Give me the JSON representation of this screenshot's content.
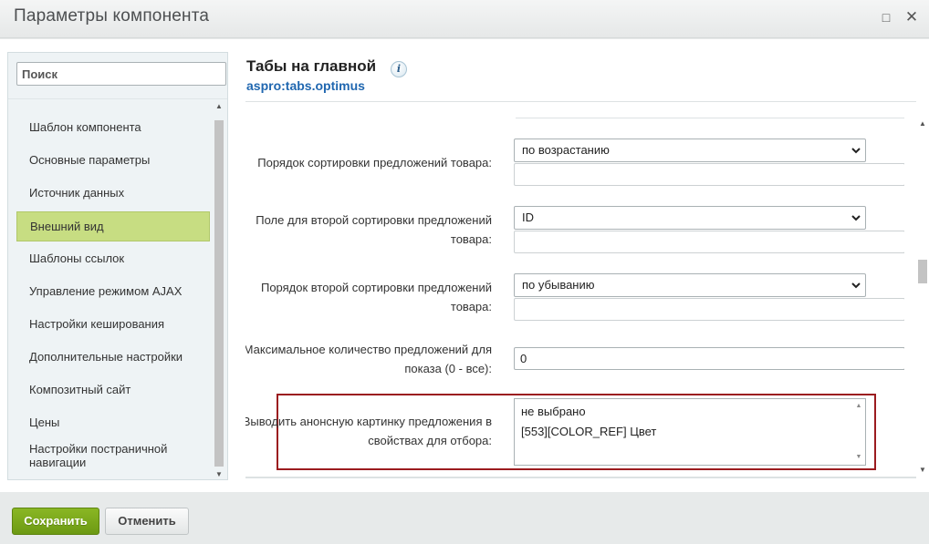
{
  "window": {
    "title": "Параметры компонента",
    "maximize_icon": "□",
    "close_icon": "✕"
  },
  "sidebar": {
    "search_placeholder": "Поиск",
    "items": [
      {
        "label": "Шаблон компонента"
      },
      {
        "label": "Основные параметры"
      },
      {
        "label": "Источник данных"
      },
      {
        "label": "Внешний вид",
        "active": true
      },
      {
        "label": "Шаблоны ссылок"
      },
      {
        "label": "Управление режимом AJAX"
      },
      {
        "label": "Настройки кеширования"
      },
      {
        "label": "Дополнительные настройки"
      },
      {
        "label": "Композитный сайт"
      },
      {
        "label": "Цены"
      },
      {
        "label": "Настройки постраничной навигации"
      }
    ]
  },
  "main": {
    "title": "Табы на главной",
    "info_icon": "i",
    "subtitle": "aspro:tabs.optimus",
    "params": [
      {
        "label": "Порядок сортировки предложений товара:",
        "value": "по возрастанию"
      },
      {
        "label": "Поле для второй сортировки предложений товара:",
        "value": "ID"
      },
      {
        "label": "Порядок второй сортировки предложений товара:",
        "value": "по убыванию"
      },
      {
        "label": "Максимальное количество предложений для показа (0 - все):",
        "value": "0"
      },
      {
        "label": "Выводить анонсную картинку предложения в свойствах для отбора:",
        "options": [
          "не выбрано",
          "[553][COLOR_REF] Цвет"
        ]
      }
    ]
  },
  "footer": {
    "save_label": "Сохранить",
    "cancel_label": "Отменить"
  },
  "colors": {
    "active_item": "#c7dd82",
    "save_button": "#7aa81c",
    "highlight_border": "#9b1b1f",
    "subtitle": "#2067b0"
  }
}
